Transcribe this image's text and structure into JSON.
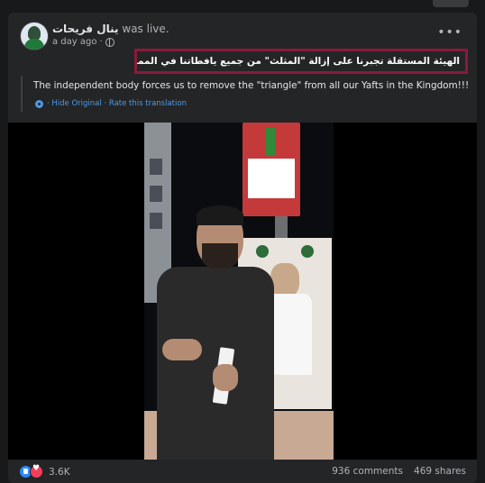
{
  "post": {
    "author": "ينال فريحات",
    "status": "was live.",
    "time": "a day ago",
    "privacy_icon": "globe-icon",
    "more_icon": "more-options-icon"
  },
  "content": {
    "arabic_text": "الهيئة المستقلة تجبرنا على إزالة \"المثلث\" من جميع يافطاتنا في المملكة!!!",
    "highlight_color": "#8b1a3a",
    "translation": "The independent body forces us to remove the \"triangle\" from all our Yafts in the Kingdom!!!",
    "hide_original": "· Hide Original · Rate this translation"
  },
  "stats": {
    "reactions": "3.6K",
    "comments": "936 comments",
    "shares": "469 shares"
  },
  "colors": {
    "background": "#18191a",
    "card": "#242526",
    "link": "#4b9ae8",
    "like": "#2d88ff",
    "love": "#f33e58"
  }
}
